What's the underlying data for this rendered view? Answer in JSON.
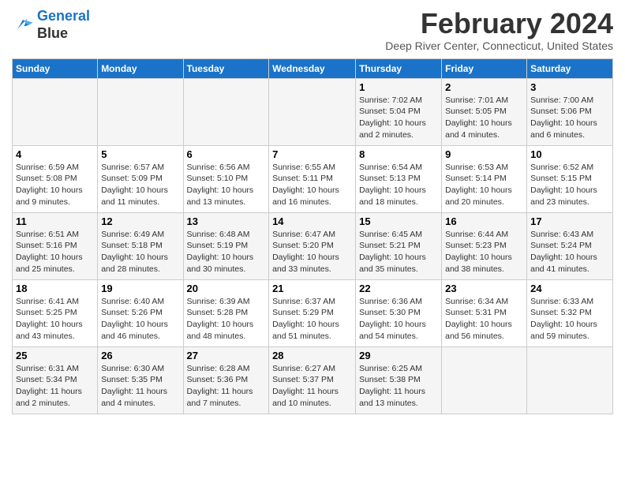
{
  "logo": {
    "line1": "General",
    "line2": "Blue"
  },
  "title": "February 2024",
  "location": "Deep River Center, Connecticut, United States",
  "weekdays": [
    "Sunday",
    "Monday",
    "Tuesday",
    "Wednesday",
    "Thursday",
    "Friday",
    "Saturday"
  ],
  "weeks": [
    [
      {
        "num": "",
        "info": ""
      },
      {
        "num": "",
        "info": ""
      },
      {
        "num": "",
        "info": ""
      },
      {
        "num": "",
        "info": ""
      },
      {
        "num": "1",
        "info": "Sunrise: 7:02 AM\nSunset: 5:04 PM\nDaylight: 10 hours\nand 2 minutes."
      },
      {
        "num": "2",
        "info": "Sunrise: 7:01 AM\nSunset: 5:05 PM\nDaylight: 10 hours\nand 4 minutes."
      },
      {
        "num": "3",
        "info": "Sunrise: 7:00 AM\nSunset: 5:06 PM\nDaylight: 10 hours\nand 6 minutes."
      }
    ],
    [
      {
        "num": "4",
        "info": "Sunrise: 6:59 AM\nSunset: 5:08 PM\nDaylight: 10 hours\nand 9 minutes."
      },
      {
        "num": "5",
        "info": "Sunrise: 6:57 AM\nSunset: 5:09 PM\nDaylight: 10 hours\nand 11 minutes."
      },
      {
        "num": "6",
        "info": "Sunrise: 6:56 AM\nSunset: 5:10 PM\nDaylight: 10 hours\nand 13 minutes."
      },
      {
        "num": "7",
        "info": "Sunrise: 6:55 AM\nSunset: 5:11 PM\nDaylight: 10 hours\nand 16 minutes."
      },
      {
        "num": "8",
        "info": "Sunrise: 6:54 AM\nSunset: 5:13 PM\nDaylight: 10 hours\nand 18 minutes."
      },
      {
        "num": "9",
        "info": "Sunrise: 6:53 AM\nSunset: 5:14 PM\nDaylight: 10 hours\nand 20 minutes."
      },
      {
        "num": "10",
        "info": "Sunrise: 6:52 AM\nSunset: 5:15 PM\nDaylight: 10 hours\nand 23 minutes."
      }
    ],
    [
      {
        "num": "11",
        "info": "Sunrise: 6:51 AM\nSunset: 5:16 PM\nDaylight: 10 hours\nand 25 minutes."
      },
      {
        "num": "12",
        "info": "Sunrise: 6:49 AM\nSunset: 5:18 PM\nDaylight: 10 hours\nand 28 minutes."
      },
      {
        "num": "13",
        "info": "Sunrise: 6:48 AM\nSunset: 5:19 PM\nDaylight: 10 hours\nand 30 minutes."
      },
      {
        "num": "14",
        "info": "Sunrise: 6:47 AM\nSunset: 5:20 PM\nDaylight: 10 hours\nand 33 minutes."
      },
      {
        "num": "15",
        "info": "Sunrise: 6:45 AM\nSunset: 5:21 PM\nDaylight: 10 hours\nand 35 minutes."
      },
      {
        "num": "16",
        "info": "Sunrise: 6:44 AM\nSunset: 5:23 PM\nDaylight: 10 hours\nand 38 minutes."
      },
      {
        "num": "17",
        "info": "Sunrise: 6:43 AM\nSunset: 5:24 PM\nDaylight: 10 hours\nand 41 minutes."
      }
    ],
    [
      {
        "num": "18",
        "info": "Sunrise: 6:41 AM\nSunset: 5:25 PM\nDaylight: 10 hours\nand 43 minutes."
      },
      {
        "num": "19",
        "info": "Sunrise: 6:40 AM\nSunset: 5:26 PM\nDaylight: 10 hours\nand 46 minutes."
      },
      {
        "num": "20",
        "info": "Sunrise: 6:39 AM\nSunset: 5:28 PM\nDaylight: 10 hours\nand 48 minutes."
      },
      {
        "num": "21",
        "info": "Sunrise: 6:37 AM\nSunset: 5:29 PM\nDaylight: 10 hours\nand 51 minutes."
      },
      {
        "num": "22",
        "info": "Sunrise: 6:36 AM\nSunset: 5:30 PM\nDaylight: 10 hours\nand 54 minutes."
      },
      {
        "num": "23",
        "info": "Sunrise: 6:34 AM\nSunset: 5:31 PM\nDaylight: 10 hours\nand 56 minutes."
      },
      {
        "num": "24",
        "info": "Sunrise: 6:33 AM\nSunset: 5:32 PM\nDaylight: 10 hours\nand 59 minutes."
      }
    ],
    [
      {
        "num": "25",
        "info": "Sunrise: 6:31 AM\nSunset: 5:34 PM\nDaylight: 11 hours\nand 2 minutes."
      },
      {
        "num": "26",
        "info": "Sunrise: 6:30 AM\nSunset: 5:35 PM\nDaylight: 11 hours\nand 4 minutes."
      },
      {
        "num": "27",
        "info": "Sunrise: 6:28 AM\nSunset: 5:36 PM\nDaylight: 11 hours\nand 7 minutes."
      },
      {
        "num": "28",
        "info": "Sunrise: 6:27 AM\nSunset: 5:37 PM\nDaylight: 11 hours\nand 10 minutes."
      },
      {
        "num": "29",
        "info": "Sunrise: 6:25 AM\nSunset: 5:38 PM\nDaylight: 11 hours\nand 13 minutes."
      },
      {
        "num": "",
        "info": ""
      },
      {
        "num": "",
        "info": ""
      }
    ]
  ]
}
